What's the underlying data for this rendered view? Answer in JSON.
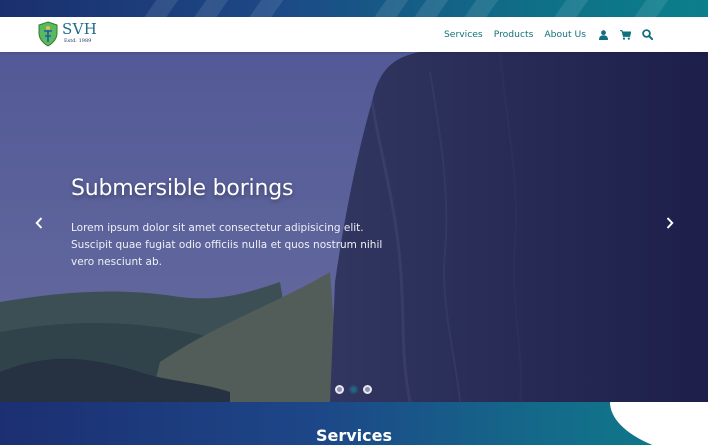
{
  "brand": {
    "name": "SVH",
    "tagline": "Estd. 1989",
    "accent_color": "#11707f",
    "shield_color": "#4aa84e"
  },
  "nav": {
    "links": [
      {
        "label": "Services"
      },
      {
        "label": "Products"
      },
      {
        "label": "About Us"
      }
    ],
    "icons": [
      "user-icon",
      "cart-icon",
      "search-icon"
    ]
  },
  "hero": {
    "title": "Submersible borings",
    "text": "Lorem ipsum dolor sit amet consectetur adipisicing elit. Suscipit quae fugiat odio officiis nulla et quos nostrum nihil vero nesciunt ab.",
    "prev_icon": "chevron-left-icon",
    "next_icon": "chevron-right-icon",
    "slide_count": 3,
    "active_slide": 2
  },
  "services": {
    "title": "Services"
  }
}
